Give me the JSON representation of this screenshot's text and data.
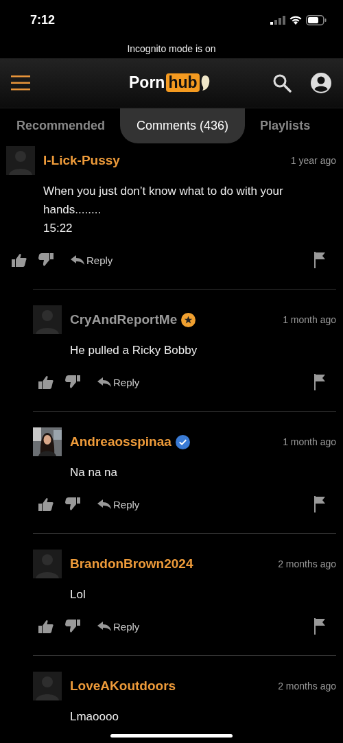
{
  "status_bar": {
    "time": "7:12"
  },
  "incognito_notice": "Incognito mode is on",
  "header": {
    "logo": {
      "first": "Porn",
      "second": "hub"
    }
  },
  "tabs": [
    {
      "label": "Recommended",
      "selected": false
    },
    {
      "label": "Comments (436)",
      "selected": true
    },
    {
      "label": "Playlists",
      "selected": false
    }
  ],
  "comments": [
    {
      "user": "I-Lick-Pussy",
      "color": "#ee9b3a",
      "avatar": {
        "kind": "silhouette"
      },
      "time": "1 year ago",
      "text": "When you just don’t know what to do with your hands........\n15:22",
      "reply": "Reply",
      "actions_visible": true,
      "children": [
        {
          "user": "CryAndReportMe",
          "color": "#9a9a9a",
          "badge": {
            "kind": "star"
          },
          "avatar": {
            "kind": "silhouette"
          },
          "time": "1 month ago",
          "text": "He pulled a Ricky Bobby",
          "reply": "Reply",
          "actions_visible": true
        },
        {
          "user": "Andreaosspinaa",
          "color": "#ee9b3a",
          "badge": {
            "kind": "verified"
          },
          "time": "1 month ago",
          "text": "Na na na",
          "reply": "Reply",
          "actions_visible": true
        },
        {
          "user": "BrandonBrown2024",
          "color": "#ee9b3a",
          "avatar": {
            "kind": "silhouette"
          },
          "time": "2 months ago",
          "text": "Lol",
          "reply": "Reply",
          "actions_visible": true
        },
        {
          "user": "LoveAKoutdoors",
          "color": "#ee9b3a",
          "avatar": {
            "kind": "silhouette"
          },
          "time": "2 months ago",
          "text": "Lmaoooo",
          "actions_visible": false
        }
      ]
    }
  ]
}
